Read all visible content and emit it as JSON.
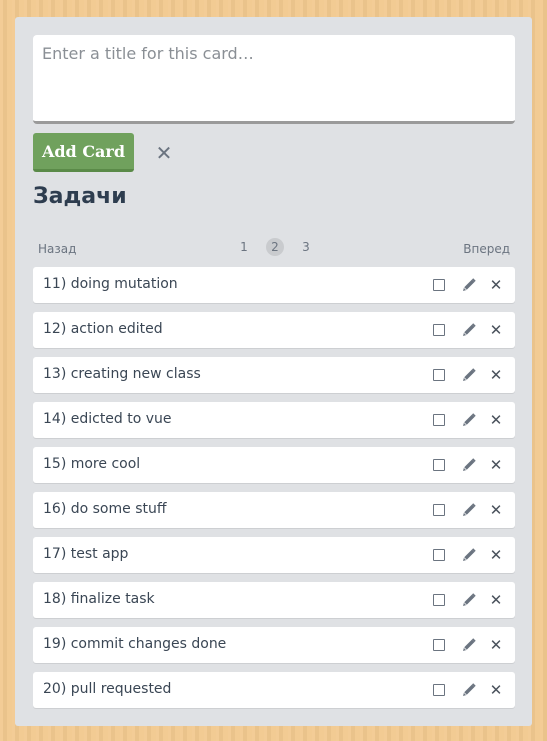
{
  "composer": {
    "placeholder": "Enter a title for this card…",
    "add_label": "Add Card",
    "cancel_icon": "close-icon"
  },
  "list": {
    "title": "Задачи"
  },
  "pagination": {
    "prev_label": "Назад",
    "next_label": "Вперед",
    "pages": [
      "1",
      "2",
      "3"
    ],
    "current": "2"
  },
  "cards": [
    {
      "label": "11) doing mutation"
    },
    {
      "label": "12) action edited"
    },
    {
      "label": "13) creating new class"
    },
    {
      "label": "14) edicted to vue"
    },
    {
      "label": "15) more cool"
    },
    {
      "label": "16) do some stuff"
    },
    {
      "label": "17) test app"
    },
    {
      "label": "18) finalize task"
    },
    {
      "label": "19) commit changes done"
    },
    {
      "label": "20) pull requested"
    }
  ],
  "card_actions": {
    "checkbox_icon": "checkbox-icon",
    "edit_icon": "pencil-icon",
    "delete_icon": "close-icon"
  },
  "colors": {
    "board_bg": "#f2c98f",
    "panel_bg": "#dfe1e4",
    "add_button": "#70a15d",
    "title_text": "#2e3d4f"
  }
}
